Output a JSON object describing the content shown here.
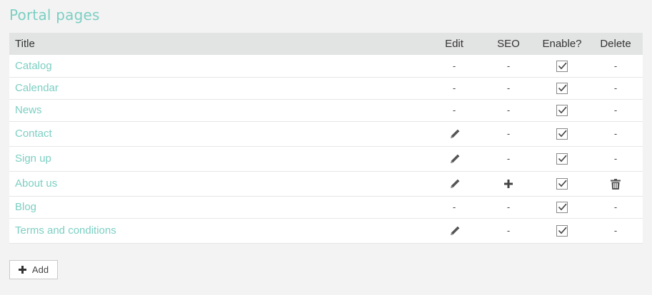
{
  "page_title": "Portal pages",
  "table": {
    "headers": {
      "title": "Title",
      "edit": "Edit",
      "seo": "SEO",
      "enable": "Enable?",
      "delete": "Delete"
    },
    "rows": [
      {
        "title": "Catalog",
        "edit": "-",
        "seo": "-",
        "enabled": true,
        "delete": "-"
      },
      {
        "title": "Calendar",
        "edit": "-",
        "seo": "-",
        "enabled": true,
        "delete": "-"
      },
      {
        "title": "News",
        "edit": "-",
        "seo": "-",
        "enabled": true,
        "delete": "-"
      },
      {
        "title": "Contact",
        "edit": "pencil-icon",
        "seo": "-",
        "enabled": true,
        "delete": "-"
      },
      {
        "title": "Sign up",
        "edit": "pencil-icon",
        "seo": "-",
        "enabled": true,
        "delete": "-"
      },
      {
        "title": "About us",
        "edit": "pencil-icon",
        "seo": "plus-icon",
        "enabled": true,
        "delete": "trash-icon"
      },
      {
        "title": "Blog",
        "edit": "-",
        "seo": "-",
        "enabled": true,
        "delete": "-"
      },
      {
        "title": "Terms and conditions",
        "edit": "pencil-icon",
        "seo": "-",
        "enabled": true,
        "delete": "-"
      }
    ]
  },
  "add_button": {
    "label": "Add",
    "icon": "plus-icon"
  },
  "colors": {
    "accent": "#7ccfc3",
    "header_bg": "#e2e3e3",
    "page_bg": "#f3f3f3"
  }
}
